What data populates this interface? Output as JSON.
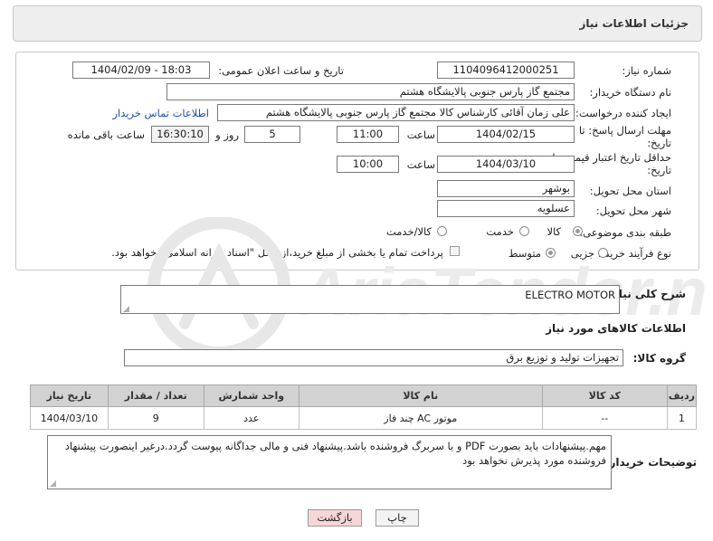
{
  "header": {
    "title": "جزئیات اطلاعات نیاز"
  },
  "form": {
    "need_number": {
      "label": "شماره نیاز:",
      "value": "1104096412000251"
    },
    "announce_datetime": {
      "label": "تاریخ و ساعت اعلان عمومی:",
      "value": "1404/02/09 - 18:03"
    },
    "buyer_org": {
      "label": "نام دستگاه خریدار:",
      "value": "مجتمع گاز پارس جنوبی  پالایشگاه هشتم"
    },
    "requester": {
      "label": "ایجاد کننده درخواست:",
      "value": "علی زمان آقائی کارشناس کالا مجتمع گاز پارس جنوبی  پالایشگاه هشتم",
      "contact_link": "اطلاعات تماس خریدار"
    },
    "response_deadline": {
      "label": "مهلت ارسال پاسخ: تا تاریخ:",
      "date": "1404/02/15",
      "time_label": "ساعت",
      "time": "11:00",
      "days": "5",
      "days_label": "روز و",
      "remaining_time": "16:30:10",
      "remaining_label": "ساعت باقی مانده"
    },
    "price_validity": {
      "label": "حداقل تاریخ اعتبار قیمت: تا تاریخ:",
      "date": "1404/03/10",
      "time_label": "ساعت",
      "time": "10:00"
    },
    "province": {
      "label": "استان محل تحویل:",
      "value": "بوشهر"
    },
    "city": {
      "label": "شهر محل تحویل:",
      "value": "عسلویه"
    },
    "category": {
      "label": "طبقه بندی موضوعی:",
      "options": [
        "کالا",
        "خدمت",
        "کالا/خدمت"
      ],
      "selected": "کالا"
    },
    "purchase_process": {
      "label": "نوع فرآیند خرید :",
      "options": [
        "جزیی",
        "متوسط"
      ],
      "selected": "متوسط",
      "payment_note": "پرداخت تمام یا بخشی از مبلغ خرید،از محل \"اسناد خزانه اسلامی\" خواهد بود."
    }
  },
  "description": {
    "label": "شرح کلی نیاز:",
    "value": "ELECTRO MOTOR"
  },
  "goods_section": {
    "title": "اطلاعات کالاهای مورد نیاز"
  },
  "goods_group": {
    "label": "گروه کالا:",
    "value": "تجهیزات تولید و توزیع برق"
  },
  "table": {
    "columns": [
      "ردیف",
      "کد کالا",
      "نام کالا",
      "واحد شمارش",
      "تعداد / مقدار",
      "تاریخ نیاز"
    ],
    "rows": [
      [
        "1",
        "--",
        "موتور AC چند فاز",
        "عدد",
        "9",
        "1404/03/10"
      ]
    ]
  },
  "buyer_notes": {
    "label": "توضیحات خریدار:",
    "value": "مهم.پیشنهادات باید بصورت PDF و با سربرگ فروشنده باشد.پیشنهاد فنی و مالی جداگانه پیوست گردد.درغیر اینصورت پیشنهاد فروشنده مورد پذیرش نخواهد بود"
  },
  "buttons": {
    "print": "چاپ",
    "back": "بازگشت"
  },
  "watermark": {
    "text": "AriaTender.neT"
  },
  "colors": {
    "link": "#1f4fa8",
    "back_button": "#f7d6d6",
    "table_header": "#d2d2d2"
  }
}
